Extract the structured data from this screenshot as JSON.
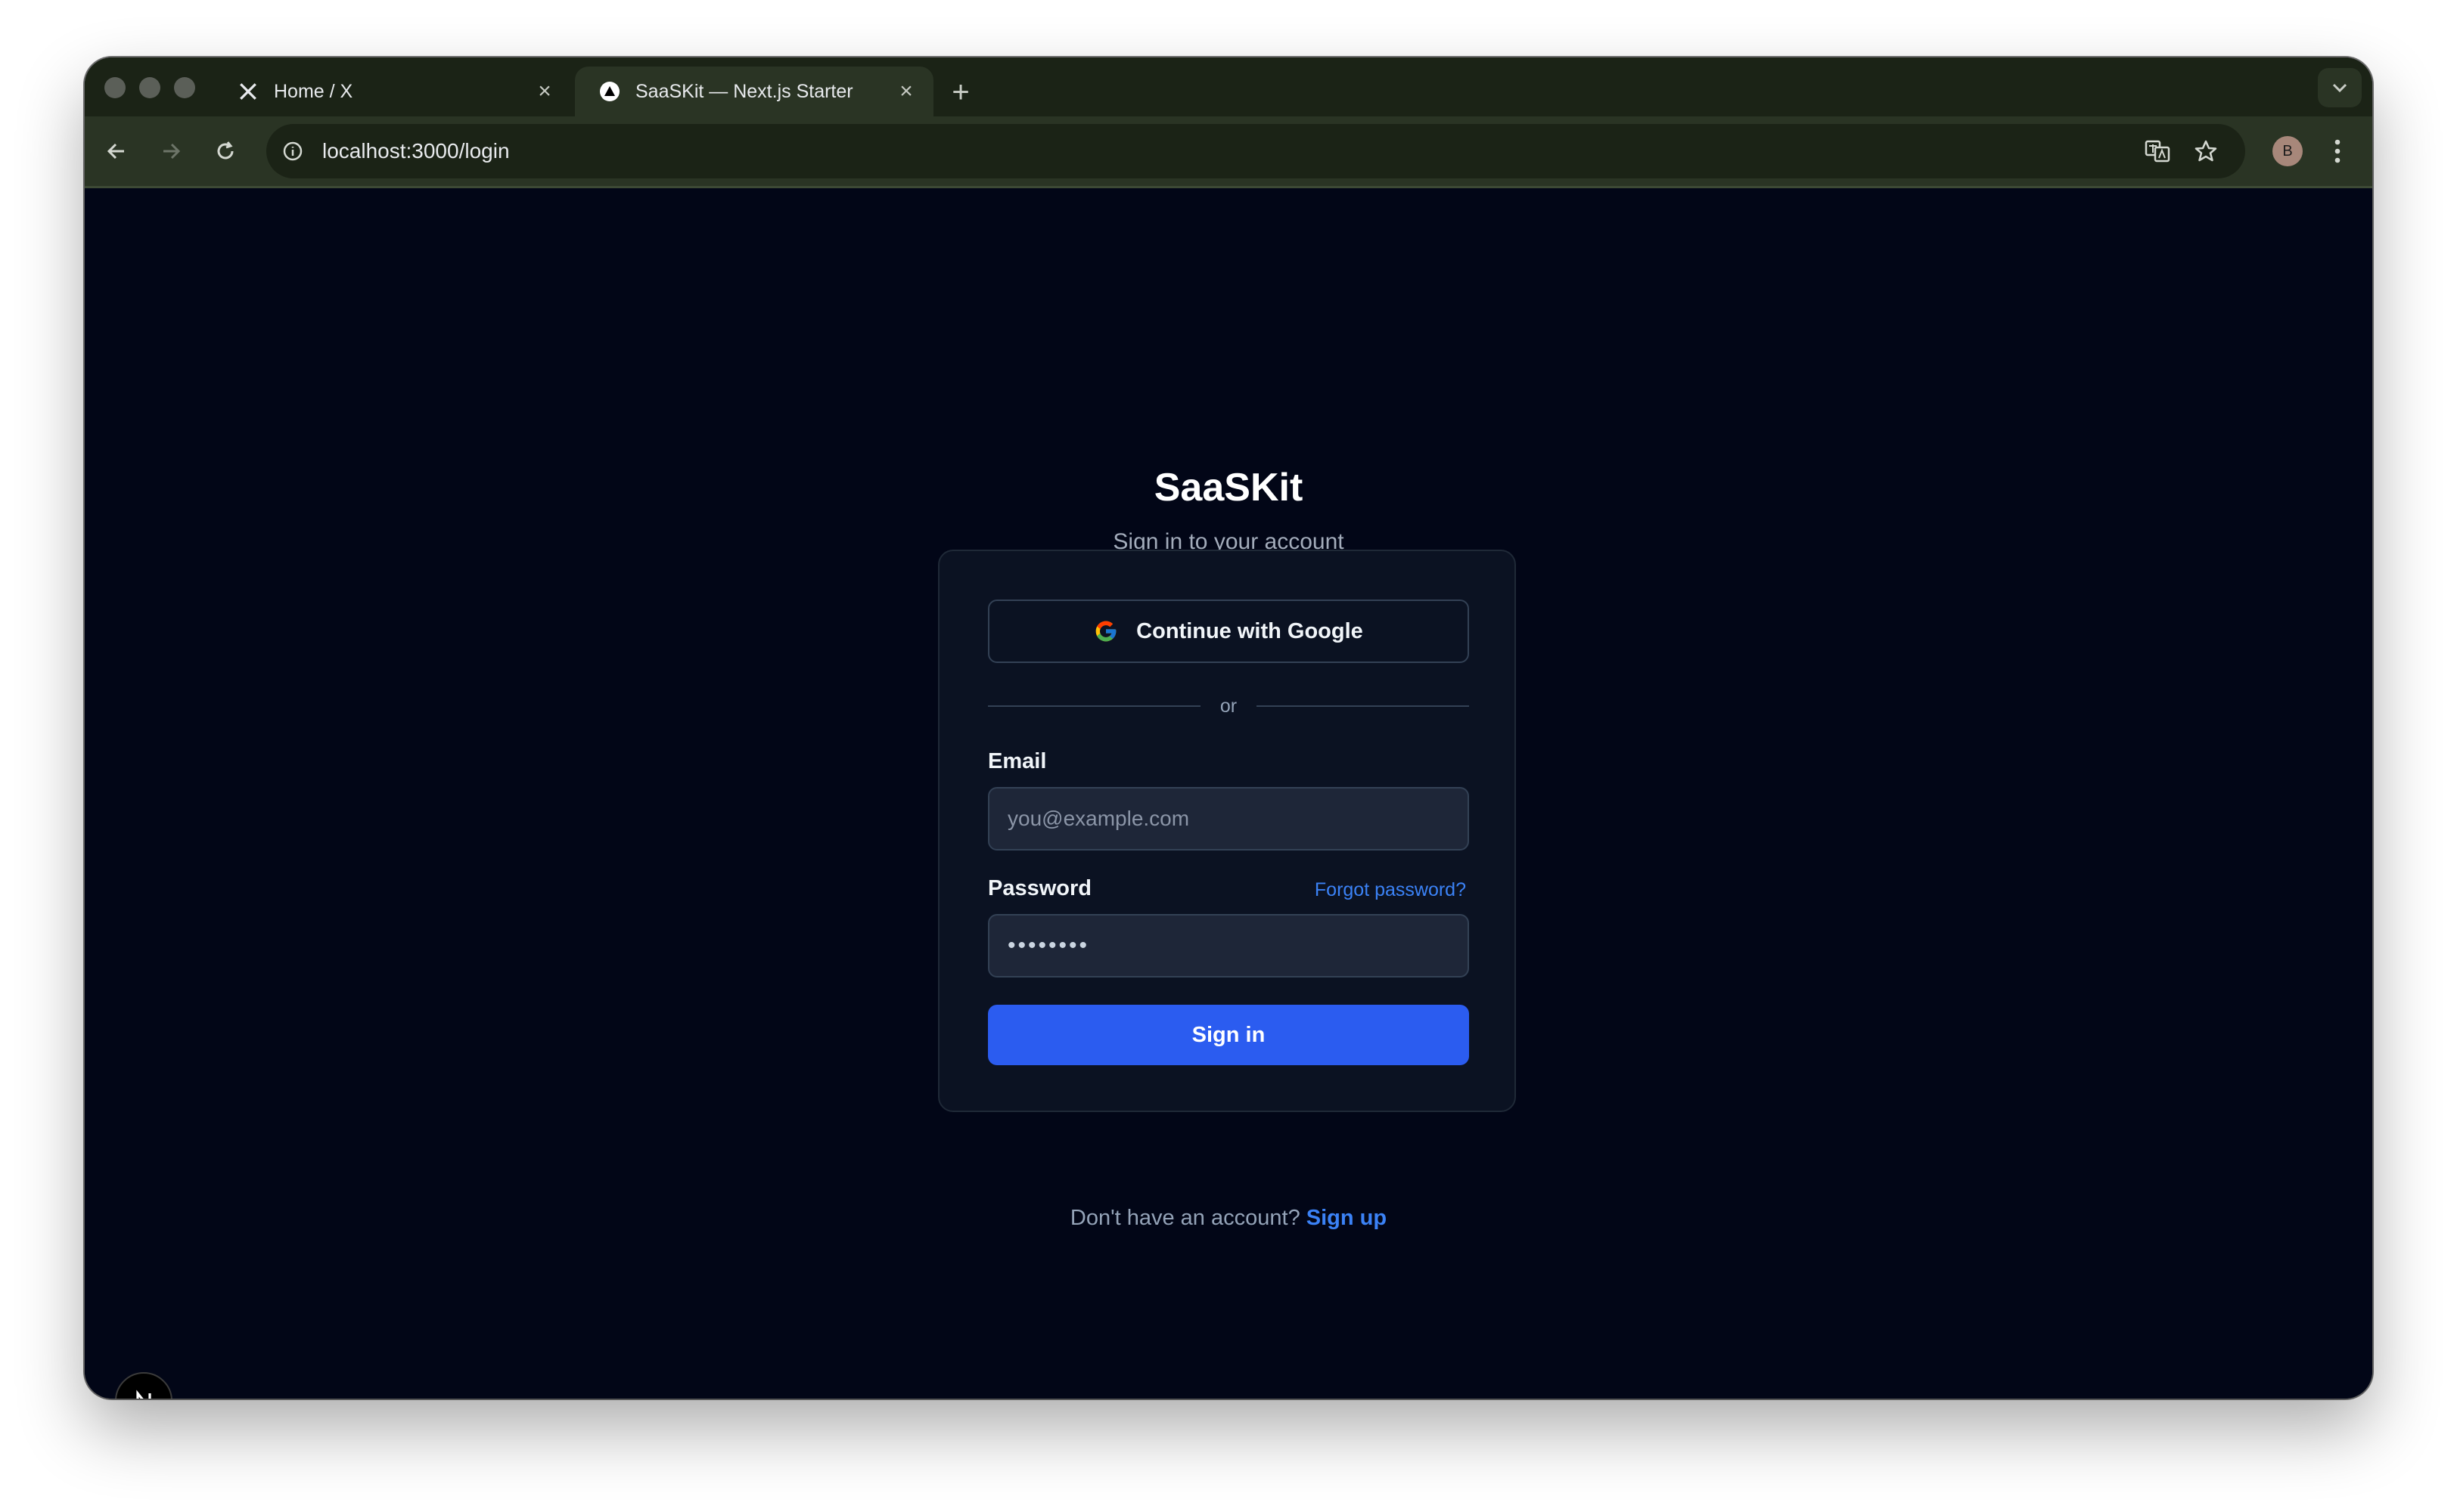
{
  "browser": {
    "tabs": [
      {
        "title": "Home / X",
        "icon": "x-logo-icon",
        "active": false
      },
      {
        "title": "SaaSKit — Next.js Starter",
        "icon": "vercel-triangle-icon",
        "active": true
      }
    ],
    "url": "localhost:3000/login",
    "profile_initial": "B"
  },
  "page": {
    "brand": "SaaSKit",
    "tagline": "Sign in to your account",
    "google_button_label": "Continue with Google",
    "divider_text": "or",
    "email": {
      "label": "Email",
      "placeholder": "you@example.com"
    },
    "password": {
      "label": "Password",
      "value": "••••••••",
      "forgot_label": "Forgot password?"
    },
    "submit_label": "Sign in",
    "signup_prompt": "Don't have an account?",
    "signup_link": "Sign up"
  },
  "colors": {
    "page_background": "#020617",
    "card_background": "#0b1222",
    "accent": "#2b5cf0",
    "link": "#3b82f6"
  }
}
